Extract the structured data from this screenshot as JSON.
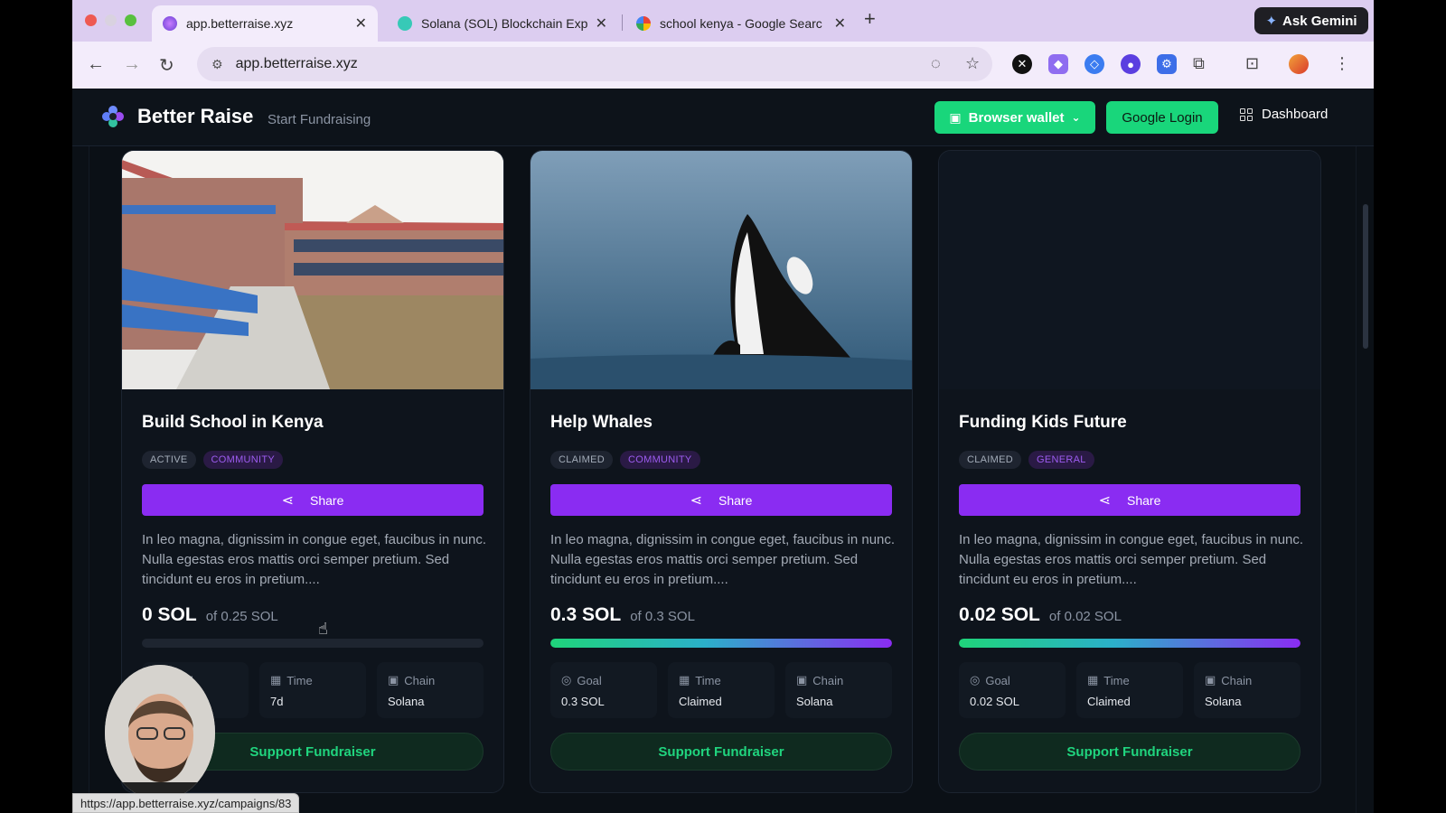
{
  "browser": {
    "tabs": [
      {
        "title": "app.betterraise.xyz",
        "active": true
      },
      {
        "title": "Solana (SOL) Blockchain Exp",
        "active": false
      },
      {
        "title": "school kenya - Google Searc",
        "active": false
      }
    ],
    "ask_gemini": "Ask Gemini",
    "url": "app.betterraise.xyz",
    "status_url": "https://app.betterraise.xyz/campaigns/83"
  },
  "header": {
    "brand": "Better Raise",
    "start_fundraising": "Start Fundraising",
    "browser_wallet": "Browser wallet",
    "google_login": "Google Login",
    "dashboard": "Dashboard"
  },
  "colors": {
    "accent_purple": "#8a2cf2",
    "accent_green": "#19d67b"
  },
  "labels": {
    "share": "Share",
    "goal": "Goal",
    "time": "Time",
    "chain": "Chain",
    "support": "Support Fundraiser"
  },
  "campaigns": [
    {
      "title": "Build School in Kenya",
      "status": "ACTIVE",
      "category": "COMMUNITY",
      "description": "In leo magna, dignissim in congue eget, faucibus in nunc. Nulla egestas eros mattis orci semper pretium. Sed tincidunt eu eros in pretium....",
      "raised": "0 SOL",
      "goal_text": "of 0.25 SOL",
      "progress": 0,
      "goal": "",
      "time": "7d",
      "chain": "Solana"
    },
    {
      "title": "Help Whales",
      "status": "CLAIMED",
      "category": "COMMUNITY",
      "description": "In leo magna, dignissim in congue eget, faucibus in nunc. Nulla egestas eros mattis orci semper pretium. Sed tincidunt eu eros in pretium....",
      "raised": "0.3 SOL",
      "goal_text": "of 0.3 SOL",
      "progress": 1,
      "goal": "0.3 SOL",
      "time": "Claimed",
      "chain": "Solana"
    },
    {
      "title": "Funding Kids Future",
      "status": "CLAIMED",
      "category": "GENERAL",
      "description": "In leo magna, dignissim in congue eget, faucibus in nunc. Nulla egestas eros mattis orci semper pretium. Sed tincidunt eu eros in pretium....",
      "raised": "0.02 SOL",
      "goal_text": "of 0.02 SOL",
      "progress": 1,
      "goal": "0.02 SOL",
      "time": "Claimed",
      "chain": "Solana"
    }
  ]
}
